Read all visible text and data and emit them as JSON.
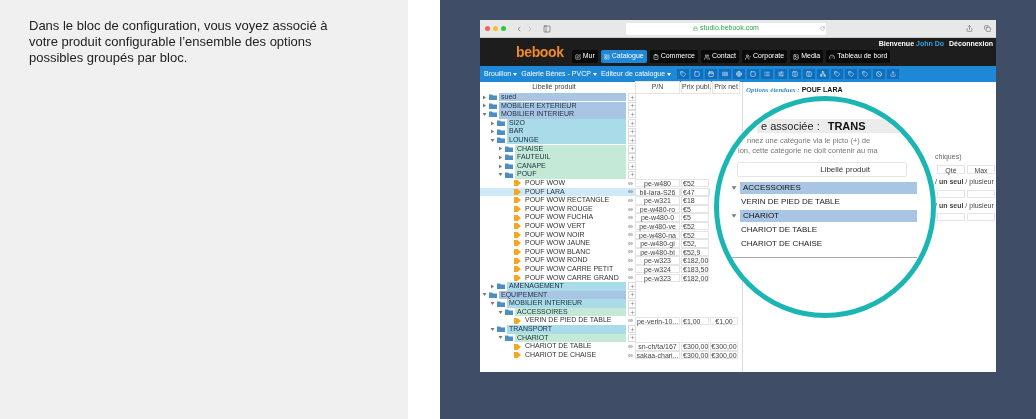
{
  "caption": "Dans le bloc de configuration, vous voyez associé à votre produit configurable l’ensemble des options possibles groupés par bloc.",
  "browser": {
    "url": "studio.bebook.com"
  },
  "app": {
    "logo": "bebook",
    "welcome": "Bienvenue",
    "user": "John Do",
    "logout": "Déconnexion",
    "nav": [
      {
        "label": "Mur",
        "selected": false
      },
      {
        "label": "Catalogue",
        "selected": true
      },
      {
        "label": "Commerce",
        "selected": false
      },
      {
        "label": "Contact",
        "selected": false
      },
      {
        "label": "Corporate",
        "selected": false
      },
      {
        "label": "Media",
        "selected": false
      },
      {
        "label": "Tableau de bord",
        "selected": false
      }
    ],
    "toolbar": {
      "dropdowns": [
        "Brouillon",
        "Galerie Bénes - PVCP",
        "Editeur de catalogue"
      ]
    }
  },
  "table": {
    "columns": [
      "Libellé produit",
      "P/N",
      "Prix publ.",
      "Prix net"
    ],
    "tree": [
      {
        "kind": "folder",
        "label": "sued",
        "expanded": false
      },
      {
        "kind": "folder",
        "label": "MOBILIER EXTERIEUR",
        "expanded": false
      },
      {
        "kind": "folder",
        "label": "MOBILIER INTERIEUR",
        "expanded": true,
        "children": [
          {
            "kind": "folder",
            "label": "SI2O",
            "expanded": false
          },
          {
            "kind": "folder",
            "label": "BAR",
            "expanded": false
          },
          {
            "kind": "folder",
            "label": "LOUNGE",
            "expanded": true,
            "children": [
              {
                "kind": "folder",
                "label": "CHAISE",
                "expanded": false
              },
              {
                "kind": "folder",
                "label": "FAUTEUIL",
                "expanded": false
              },
              {
                "kind": "folder",
                "label": "CANAPE",
                "expanded": false
              },
              {
                "kind": "folder",
                "label": "POUF",
                "expanded": true,
                "children": [
                  {
                    "kind": "product",
                    "label": "POUF WOW",
                    "ref": "pe-w480",
                    "publ": "€52",
                    "selected": false
                  },
                  {
                    "kind": "product",
                    "label": "POUF LARA",
                    "ref": "bli-lara-S26",
                    "publ": "€47",
                    "selected": true
                  },
                  {
                    "kind": "product",
                    "label": "POUF WOW RECTANGLE",
                    "ref": "pe-w321",
                    "publ": "€18",
                    "selected": false
                  },
                  {
                    "kind": "product",
                    "label": "POUF WOW ROUGE",
                    "ref": "pe-w480-ro",
                    "publ": "€5",
                    "selected": false
                  },
                  {
                    "kind": "product",
                    "label": "POUF WOW FUCHIA",
                    "ref": "pe-w480-0",
                    "publ": "€5",
                    "selected": false
                  },
                  {
                    "kind": "product",
                    "label": "POUF WOW VERT",
                    "ref": "pe-w480-ve",
                    "publ": "€52",
                    "selected": false
                  },
                  {
                    "kind": "product",
                    "label": "POUF WOW NOIR",
                    "ref": "pe-w480-na",
                    "publ": "€52",
                    "selected": false
                  },
                  {
                    "kind": "product",
                    "label": "POUF WOW JAUNE",
                    "ref": "pe-w480-gi",
                    "publ": "€52,",
                    "selected": false
                  },
                  {
                    "kind": "product",
                    "label": "POUF WOW BLANC",
                    "ref": "pe-w480-bl",
                    "publ": "€52,9",
                    "selected": false
                  },
                  {
                    "kind": "product",
                    "label": "POUF WOW ROND",
                    "ref": "pe-w323",
                    "publ": "€182,00",
                    "selected": false
                  },
                  {
                    "kind": "product",
                    "label": "POUF WOW CARRE PETIT",
                    "ref": "pe-w324",
                    "publ": "€183,50",
                    "selected": false
                  },
                  {
                    "kind": "product",
                    "label": "POUF WOW CARRE GRAND",
                    "ref": "pe-w323",
                    "publ": "€182,00",
                    "selected": false
                  }
                ]
              }
            ]
          },
          {
            "kind": "folder",
            "label": "AMENAGEMENT",
            "expanded": false
          }
        ]
      },
      {
        "kind": "folder",
        "label": "EQUIPEMENT",
        "expanded": true,
        "children": [
          {
            "kind": "folder",
            "label": "MOBILIER INTERIEUR",
            "expanded": true,
            "children": [
              {
                "kind": "folder",
                "label": "ACCESSOIRES",
                "expanded": true,
                "children": [
                  {
                    "kind": "product",
                    "label": "VERIN DE PIED DE TABLE",
                    "ref": "pe-verin-10...",
                    "publ": "€1,00",
                    "net": "€1,00",
                    "selected": false
                  }
                ]
              }
            ]
          },
          {
            "kind": "folder",
            "label": "TRANSPORT",
            "expanded": true,
            "children": [
              {
                "kind": "folder",
                "label": "CHARIOT",
                "expanded": true,
                "children": [
                  {
                    "kind": "product",
                    "label": "CHARIOT DE TABLE",
                    "ref": "sn-ch/ta/167",
                    "publ": "€300,00",
                    "net": "€300,00",
                    "selected": false
                  },
                  {
                    "kind": "product",
                    "label": "CHARIOT DE CHAISE",
                    "ref": "sakaa-chari...",
                    "publ": "€300,00",
                    "net": "€300,00",
                    "selected": false
                  }
                ]
              }
            ]
          }
        ]
      }
    ]
  },
  "options": {
    "title": "Options étendues :",
    "product": "POUF LARA",
    "note": "chiques)",
    "columns": [
      "Qté",
      "Max"
    ],
    "choices": [
      "/ **un seul** / plusieur",
      "/ **un seul** / plusieur"
    ]
  },
  "magnifier": {
    "heading_label": "e associée :",
    "heading_value": "TRANS",
    "lines": [
      "nnez une catégorie via le picto (+) de",
      "ion, cette catégorie ne doit contenir au ma"
    ],
    "column": "Libellé produit",
    "rows": [
      {
        "kind": "group",
        "label": "ACCESSOIRES",
        "expanded": true
      },
      {
        "kind": "item",
        "label": "VERIN DE PIED DE TABLE"
      },
      {
        "kind": "group",
        "label": "CHARIOT",
        "expanded": true
      },
      {
        "kind": "item",
        "label": "CHARIOT DE TABLE"
      },
      {
        "kind": "item",
        "label": "CHARIOT DE CHAISE"
      }
    ]
  }
}
